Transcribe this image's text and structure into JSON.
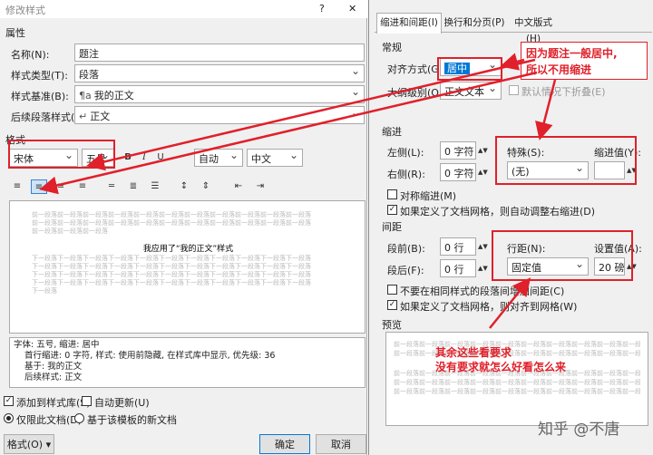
{
  "left_dialog": {
    "title": "修改样式",
    "help": "?",
    "close": "✕",
    "section_properties": "属性",
    "name_label": "名称(N):",
    "name_value": "题注",
    "type_label": "样式类型(T):",
    "type_value": "段落",
    "based_label": "样式基准(B):",
    "based_value": "我的正文",
    "based_icon": "¶a",
    "next_label": "后续段落样式(S):",
    "next_value": "正文",
    "next_icon": "↵",
    "section_format": "格式",
    "font_value": "宋体",
    "size_value": "五号",
    "bold": "B",
    "italic": "I",
    "underline": "U",
    "color_value": "自动",
    "lang_value": "中文",
    "preview_prev_lines": [
      "前一段落前一段落前一段落前一段落前一段落前一段落前一段落前一段落前一段落前一段落前一段落",
      "前一段落前一段落前一段落前一段落前一段落前一段落前一段落前一段落前一段落前一段落前一段落",
      "前一段落前一段落前一段落"
    ],
    "preview_sample": "我应用了“我的正文”样式",
    "preview_next_lines": [
      "下一段落下一段落下一段落下一段落下一段落下一段落下一段落下一段落下一段落下一段落下一段落",
      "下一段落下一段落下一段落下一段落下一段落下一段落下一段落下一段落下一段落下一段落下一段落",
      "下一段落下一段落下一段落下一段落下一段落下一段落下一段落下一段落下一段落下一段落下一段落",
      "下一段落下一段落下一段落下一段落下一段落下一段落下一段落下一段落下一段落下一段落下一段落",
      "下一段落"
    ],
    "desc_line1": "字体: 五号, 缩进: 居中",
    "desc_line2": "首行缩进:  0 字符, 样式: 使用前隐藏, 在样式库中显示, 优先级: 36",
    "desc_line3": "基于: 我的正文",
    "desc_line4": "后续样式: 正文",
    "add_to_gallery": "添加到样式库(S)",
    "auto_update": "自动更新(U)",
    "only_this_doc": "仅限此文档(D)",
    "new_docs": "基于该模板的新文档",
    "format_button": "格式(O) ▾",
    "ok": "确定",
    "cancel": "取消"
  },
  "right_dialog": {
    "tabs": [
      "缩进和间距(I)",
      "换行和分页(P)",
      "中文版式(H)"
    ],
    "general": "常规",
    "align_label": "对齐方式(G):",
    "align_value": "居中",
    "outline_label": "大纲级别(O):",
    "outline_value": "正文文本",
    "collapse_label": "默认情况下折叠(E)",
    "indent": "缩进",
    "left_label": "左侧(L):",
    "left_value": "0 字符",
    "right_label": "右侧(R):",
    "right_value": "0 字符",
    "special_label": "特殊(S):",
    "special_value": "(无)",
    "indent_by_label": "缩进值(Y):",
    "mirror_label": "对称缩进(M)",
    "auto_adjust_label": "如果定义了文档网格，则自动调整右缩进(D)",
    "spacing": "间距",
    "before_label": "段前(B):",
    "before_value": "0 行",
    "after_label": "段后(F):",
    "after_value": "0 行",
    "line_spacing_label": "行距(N):",
    "line_spacing_value": "固定值",
    "at_label": "设置值(A):",
    "at_value": "20 磅",
    "no_space_label": "不要在相同样式的段落间增加间距(C)",
    "snap_grid_label": "如果定义了文档网格，则对齐到网格(W)",
    "preview": "预览",
    "preview_line": "前一段落前一段落前一段落前一段落前一段落前一段落前一段落前一段落前一段落前一段落前一段落前一段落"
  },
  "annotations": {
    "top_note_line1": "因为题注一般居中,",
    "top_note_line2": "所以不用缩进",
    "bottom_note_line1": "其余这些看要求",
    "bottom_note_line2": "没有要求就怎么好看怎么来"
  },
  "watermark": "知乎 @不唐",
  "colors": {
    "accent_red": "#e0202a",
    "selection_blue": "#0078d7"
  }
}
